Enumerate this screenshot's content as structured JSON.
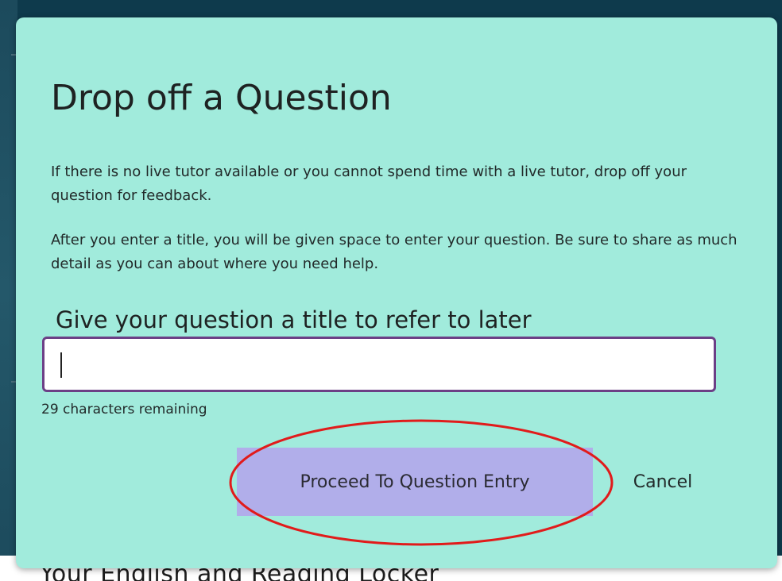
{
  "background": {
    "partial_heading": "Your English and Reading Locker"
  },
  "dialog": {
    "title": "Drop off a Question",
    "paragraph_1": "If there is no live tutor available or you cannot spend time with a live tutor, drop off your question for feedback.",
    "paragraph_2": "After you enter a title, you will be given space to enter your question. Be sure to share as much detail as you can about where you need help.",
    "field_label": "Give your question a title to refer to later",
    "title_input_value": "",
    "char_count": "29 characters remaining",
    "proceed_label": "Proceed To Question Entry",
    "cancel_label": "Cancel"
  },
  "colors": {
    "dialog_bg": "#a1ebdc",
    "page_bg": "#0e3a4c",
    "primary_button": "#b1aeea",
    "input_border": "#6c3f86",
    "annotation": "#e11b1b"
  },
  "annotation": {
    "shape": "ellipse",
    "color": "#e11b1b",
    "target": "proceed-button"
  }
}
